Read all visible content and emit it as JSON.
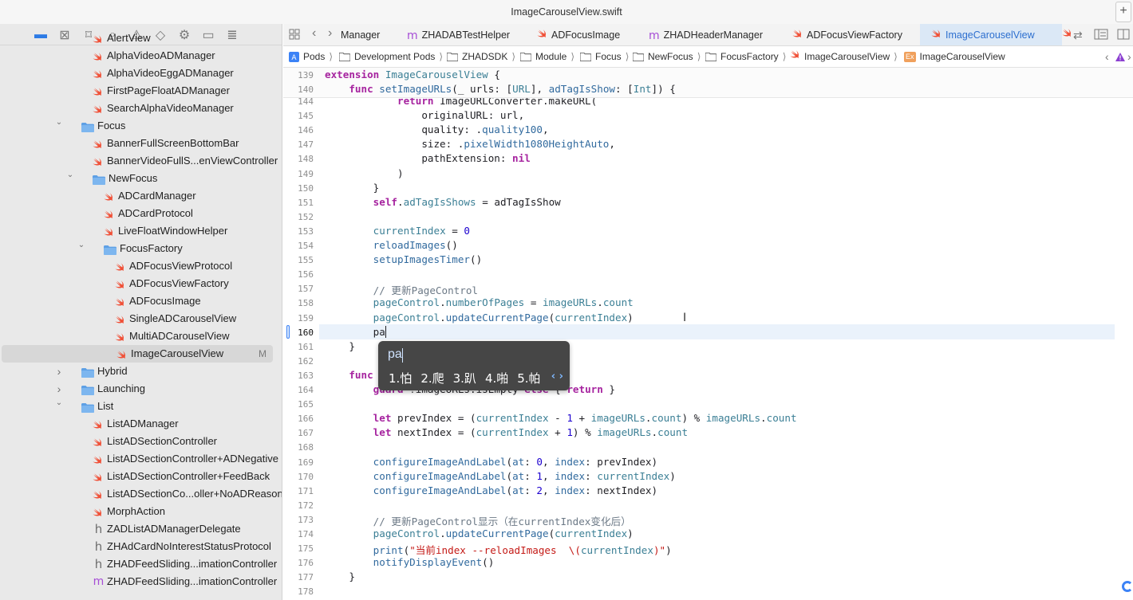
{
  "window": {
    "title": "ImageCarouselView.swift",
    "add_label": "+"
  },
  "navigator": {
    "icons": [
      "folder-icon",
      "source-control-icon",
      "bookmark-icon",
      "find-icon",
      "issue-icon",
      "test-icon",
      "debug-icon",
      "breakpoint-icon",
      "report-icon"
    ],
    "items": [
      {
        "label": "AlertView",
        "type": "swift",
        "depth": 2
      },
      {
        "label": "AlphaVideoADManager",
        "type": "swift",
        "depth": 2
      },
      {
        "label": "AlphaVideoEggADManager",
        "type": "swift",
        "depth": 2
      },
      {
        "label": "FirstPageFloatADManager",
        "type": "swift",
        "depth": 2
      },
      {
        "label": "SearchAlphaVideoManager",
        "type": "swift",
        "depth": 2
      },
      {
        "label": "Focus",
        "type": "folder",
        "depth": 1,
        "expanded": true
      },
      {
        "label": "BannerFullScreenBottomBar",
        "type": "swift",
        "depth": 2
      },
      {
        "label": "BannerVideoFullS...enViewController",
        "type": "swift",
        "depth": 2
      },
      {
        "label": "NewFocus",
        "type": "folder",
        "depth": 2,
        "expanded": true
      },
      {
        "label": "ADCardManager",
        "type": "swift",
        "depth": 3
      },
      {
        "label": "ADCardProtocol",
        "type": "swift",
        "depth": 3
      },
      {
        "label": "LiveFloatWindowHelper",
        "type": "swift",
        "depth": 3
      },
      {
        "label": "FocusFactory",
        "type": "folder",
        "depth": 3,
        "expanded": true
      },
      {
        "label": "ADFocusViewProtocol",
        "type": "swift",
        "depth": 4
      },
      {
        "label": "ADFocusViewFactory",
        "type": "swift",
        "depth": 4
      },
      {
        "label": "ADFocusImage",
        "type": "swift",
        "depth": 4
      },
      {
        "label": "SingleADCarouselView",
        "type": "swift",
        "depth": 4
      },
      {
        "label": "MultiADCarouselView",
        "type": "swift",
        "depth": 4
      },
      {
        "label": "ImageCarouselView",
        "type": "swift",
        "depth": 4,
        "selected": true,
        "badge": "M"
      },
      {
        "label": "Hybrid",
        "type": "folder",
        "depth": 1,
        "expanded": false
      },
      {
        "label": "Launching",
        "type": "folder",
        "depth": 1,
        "expanded": false
      },
      {
        "label": "List",
        "type": "folder",
        "depth": 1,
        "expanded": true
      },
      {
        "label": "ListADManager",
        "type": "swift",
        "depth": 2
      },
      {
        "label": "ListADSectionController",
        "type": "swift",
        "depth": 2
      },
      {
        "label": "ListADSectionController+ADNegative",
        "type": "swift",
        "depth": 2
      },
      {
        "label": "ListADSectionController+FeedBack",
        "type": "swift",
        "depth": 2
      },
      {
        "label": "ListADSectionCo...oller+NoADReason",
        "type": "swift",
        "depth": 2
      },
      {
        "label": "MorphAction",
        "type": "swift",
        "depth": 2
      },
      {
        "label": "ZADListADManagerDelegate",
        "type": "header",
        "depth": 2
      },
      {
        "label": "ZHAdCardNoInterestStatusProtocol",
        "type": "header",
        "depth": 2
      },
      {
        "label": "ZHADFeedSliding...imationController",
        "type": "header",
        "depth": 2
      },
      {
        "label": "ZHADFeedSliding...imationController",
        "type": "objc",
        "depth": 2
      }
    ]
  },
  "tabs": [
    {
      "label": "Manager",
      "type": "none"
    },
    {
      "label": "ZHADABTestHelper",
      "type": "objc"
    },
    {
      "label": "ADFocusImage",
      "type": "swift"
    },
    {
      "label": "ZHADHeaderManager",
      "type": "objc"
    },
    {
      "label": "ADFocusViewFactory",
      "type": "swift"
    },
    {
      "label": "ImageCarouselView",
      "type": "swift",
      "active": true
    }
  ],
  "jumpbar": [
    {
      "label": "Pods",
      "icon": "project-icon"
    },
    {
      "label": "Development Pods",
      "icon": "folder-icon"
    },
    {
      "label": "ZHADSDK",
      "icon": "folder-icon"
    },
    {
      "label": "Module",
      "icon": "folder-icon"
    },
    {
      "label": "Focus",
      "icon": "folder-icon"
    },
    {
      "label": "NewFocus",
      "icon": "folder-icon"
    },
    {
      "label": "FocusFactory",
      "icon": "folder-icon"
    },
    {
      "label": "ImageCarouselView",
      "icon": "swift-icon"
    },
    {
      "label": "ImageCarouselView",
      "icon": "extension-icon"
    }
  ],
  "jumpbar_ext_badge": "Ex",
  "editor": {
    "sticky": [
      {
        "num": "139",
        "segs": [
          [
            "k",
            "extension"
          ],
          [
            "p",
            " "
          ],
          [
            "t",
            "ImageCarouselView"
          ],
          [
            "p",
            " {"
          ]
        ]
      },
      {
        "num": "140",
        "segs": [
          [
            "p",
            "    "
          ],
          [
            "k",
            "func"
          ],
          [
            "p",
            " "
          ],
          [
            "f",
            "setImageURLs"
          ],
          [
            "p",
            "(_ urls: ["
          ],
          [
            "t",
            "URL"
          ],
          [
            "p",
            "], "
          ],
          [
            "f",
            "adTagIsShow"
          ],
          [
            "p",
            ": ["
          ],
          [
            "t",
            "Int"
          ],
          [
            "p",
            "]) {"
          ]
        ]
      }
    ],
    "lines": [
      {
        "num": "144",
        "segs": [
          [
            "p",
            "            "
          ],
          [
            "k",
            "return"
          ],
          [
            "p",
            " ImageURLConverter.makeURL("
          ]
        ]
      },
      {
        "num": "145",
        "segs": [
          [
            "p",
            "                originalURL: url,"
          ]
        ]
      },
      {
        "num": "146",
        "segs": [
          [
            "p",
            "                quality: ."
          ],
          [
            "f",
            "quality100"
          ],
          [
            "p",
            ","
          ]
        ]
      },
      {
        "num": "147",
        "segs": [
          [
            "p",
            "                size: ."
          ],
          [
            "f",
            "pixelWidth1080HeightAuto"
          ],
          [
            "p",
            ","
          ]
        ]
      },
      {
        "num": "148",
        "segs": [
          [
            "p",
            "                pathExtension: "
          ],
          [
            "k",
            "nil"
          ]
        ]
      },
      {
        "num": "149",
        "segs": [
          [
            "p",
            "            )"
          ]
        ]
      },
      {
        "num": "150",
        "segs": [
          [
            "p",
            "        }"
          ]
        ]
      },
      {
        "num": "151",
        "segs": [
          [
            "p",
            "        "
          ],
          [
            "k",
            "self"
          ],
          [
            "p",
            "."
          ],
          [
            "t",
            "adTagIsShows"
          ],
          [
            "p",
            " = adTagIsShow"
          ]
        ]
      },
      {
        "num": "152",
        "segs": []
      },
      {
        "num": "153",
        "segs": [
          [
            "p",
            "        "
          ],
          [
            "t",
            "currentIndex"
          ],
          [
            "p",
            " = "
          ],
          [
            "n",
            "0"
          ]
        ]
      },
      {
        "num": "154",
        "segs": [
          [
            "p",
            "        "
          ],
          [
            "f",
            "reloadImages"
          ],
          [
            "p",
            "()"
          ]
        ]
      },
      {
        "num": "155",
        "segs": [
          [
            "p",
            "        "
          ],
          [
            "f",
            "setupImagesTimer"
          ],
          [
            "p",
            "()"
          ]
        ]
      },
      {
        "num": "156",
        "segs": []
      },
      {
        "num": "157",
        "segs": [
          [
            "p",
            "        "
          ],
          [
            "c",
            "// 更新PageControl"
          ]
        ]
      },
      {
        "num": "158",
        "segs": [
          [
            "p",
            "        "
          ],
          [
            "t",
            "pageControl"
          ],
          [
            "p",
            "."
          ],
          [
            "t",
            "numberOfPages"
          ],
          [
            "p",
            " = "
          ],
          [
            "t",
            "imageURLs"
          ],
          [
            "p",
            "."
          ],
          [
            "t",
            "count"
          ]
        ]
      },
      {
        "num": "159",
        "segs": [
          [
            "p",
            "        "
          ],
          [
            "t",
            "pageControl"
          ],
          [
            "p",
            "."
          ],
          [
            "f",
            "updateCurrentPage"
          ],
          [
            "p",
            "("
          ],
          [
            "t",
            "currentIndex"
          ],
          [
            "p",
            ")"
          ]
        ]
      },
      {
        "num": "160",
        "segs": [
          [
            "p",
            "        pa"
          ]
        ],
        "current": true
      },
      {
        "num": "161",
        "segs": [
          [
            "p",
            "    }"
          ]
        ]
      },
      {
        "num": "162",
        "segs": []
      },
      {
        "num": "163",
        "segs": [
          [
            "p",
            "    "
          ],
          [
            "k",
            "func"
          ],
          [
            "p",
            " reloadImages() {"
          ]
        ]
      },
      {
        "num": "164",
        "segs": [
          [
            "p",
            "        "
          ],
          [
            "k",
            "guard"
          ],
          [
            "p",
            " !imageURLs.isEmpty "
          ],
          [
            "k",
            "else"
          ],
          [
            "p",
            " { "
          ],
          [
            "k",
            "return"
          ],
          [
            "p",
            " }"
          ]
        ]
      },
      {
        "num": "165",
        "segs": []
      },
      {
        "num": "166",
        "segs": [
          [
            "p",
            "        "
          ],
          [
            "k",
            "let"
          ],
          [
            "p",
            " prevIndex = ("
          ],
          [
            "t",
            "currentIndex"
          ],
          [
            "p",
            " - "
          ],
          [
            "n",
            "1"
          ],
          [
            "p",
            " + "
          ],
          [
            "t",
            "imageURLs"
          ],
          [
            "p",
            "."
          ],
          [
            "t",
            "count"
          ],
          [
            "p",
            ") % "
          ],
          [
            "t",
            "imageURLs"
          ],
          [
            "p",
            "."
          ],
          [
            "t",
            "count"
          ]
        ]
      },
      {
        "num": "167",
        "segs": [
          [
            "p",
            "        "
          ],
          [
            "k",
            "let"
          ],
          [
            "p",
            " nextIndex = ("
          ],
          [
            "t",
            "currentIndex"
          ],
          [
            "p",
            " + "
          ],
          [
            "n",
            "1"
          ],
          [
            "p",
            ") % "
          ],
          [
            "t",
            "imageURLs"
          ],
          [
            "p",
            "."
          ],
          [
            "t",
            "count"
          ]
        ]
      },
      {
        "num": "168",
        "segs": []
      },
      {
        "num": "169",
        "segs": [
          [
            "p",
            "        "
          ],
          [
            "f",
            "configureImageAndLabel"
          ],
          [
            "p",
            "("
          ],
          [
            "f",
            "at"
          ],
          [
            "p",
            ": "
          ],
          [
            "n",
            "0"
          ],
          [
            "p",
            ", "
          ],
          [
            "f",
            "index"
          ],
          [
            "p",
            ": prevIndex)"
          ]
        ]
      },
      {
        "num": "170",
        "segs": [
          [
            "p",
            "        "
          ],
          [
            "f",
            "configureImageAndLabel"
          ],
          [
            "p",
            "("
          ],
          [
            "f",
            "at"
          ],
          [
            "p",
            ": "
          ],
          [
            "n",
            "1"
          ],
          [
            "p",
            ", "
          ],
          [
            "f",
            "index"
          ],
          [
            "p",
            ": "
          ],
          [
            "t",
            "currentIndex"
          ],
          [
            "p",
            ")"
          ]
        ]
      },
      {
        "num": "171",
        "segs": [
          [
            "p",
            "        "
          ],
          [
            "f",
            "configureImageAndLabel"
          ],
          [
            "p",
            "("
          ],
          [
            "f",
            "at"
          ],
          [
            "p",
            ": "
          ],
          [
            "n",
            "2"
          ],
          [
            "p",
            ", "
          ],
          [
            "f",
            "index"
          ],
          [
            "p",
            ": nextIndex)"
          ]
        ]
      },
      {
        "num": "172",
        "segs": []
      },
      {
        "num": "173",
        "segs": [
          [
            "p",
            "        "
          ],
          [
            "c",
            "// 更新PageControl显示（在currentIndex变化后）"
          ]
        ]
      },
      {
        "num": "174",
        "segs": [
          [
            "p",
            "        "
          ],
          [
            "t",
            "pageControl"
          ],
          [
            "p",
            "."
          ],
          [
            "f",
            "updateCurrentPage"
          ],
          [
            "p",
            "("
          ],
          [
            "t",
            "currentIndex"
          ],
          [
            "p",
            ")"
          ]
        ]
      },
      {
        "num": "175",
        "segs": [
          [
            "p",
            "        "
          ],
          [
            "f",
            "print"
          ],
          [
            "p",
            "("
          ],
          [
            "s",
            "\"当前index --reloadImages  \\("
          ],
          [
            "t",
            "currentIndex"
          ],
          [
            "s",
            ")\""
          ],
          [
            "p",
            ")"
          ]
        ]
      },
      {
        "num": "176",
        "segs": [
          [
            "p",
            "        "
          ],
          [
            "f",
            "notifyDisplayEvent"
          ],
          [
            "p",
            "()"
          ]
        ]
      },
      {
        "num": "177",
        "segs": [
          [
            "p",
            "    }"
          ]
        ]
      },
      {
        "num": "178",
        "segs": []
      }
    ]
  },
  "ime": {
    "composition": "pa",
    "candidates": [
      "1.怕",
      "2.爬",
      "3.趴",
      "4.啪",
      "5.帕"
    ],
    "more_label": "‹ ›"
  },
  "colors": {
    "accent": "#2d6fcf",
    "swift_orange": "#f05138",
    "folder_blue": "#5ea0e5",
    "keyword": "#a6239f"
  }
}
